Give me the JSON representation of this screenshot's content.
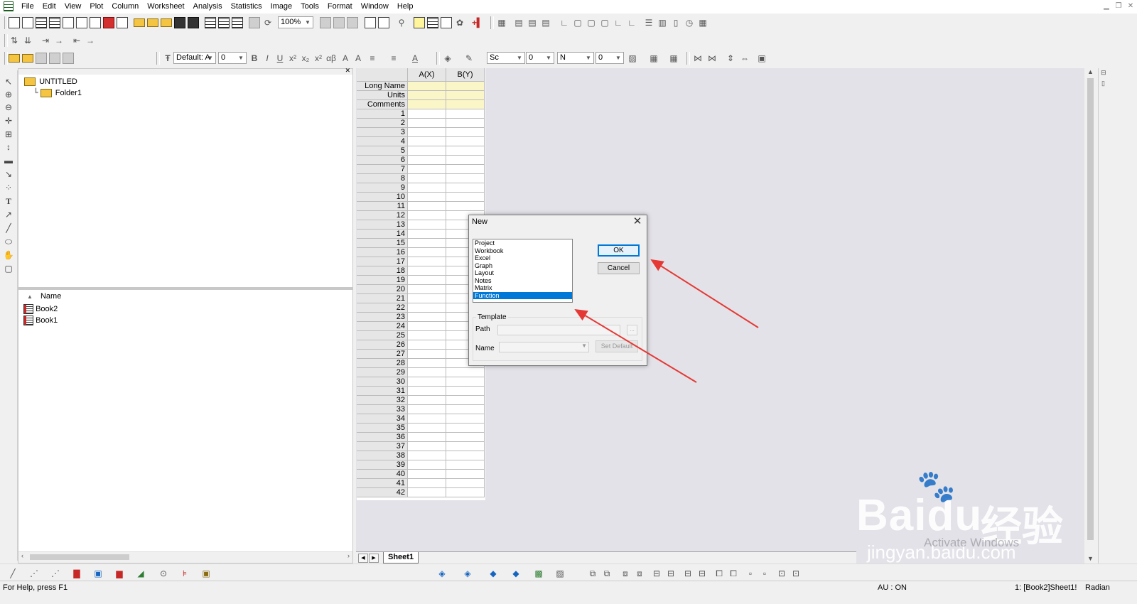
{
  "menubar": {
    "items": [
      "File",
      "Edit",
      "View",
      "Plot",
      "Column",
      "Worksheet",
      "Analysis",
      "Statistics",
      "Image",
      "Tools",
      "Format",
      "Window",
      "Help"
    ]
  },
  "toolbar": {
    "zoom": "100%",
    "font_name": "Default: A",
    "font_size": "0",
    "line_style": "Sc",
    "line_width": "0",
    "fill_box": "N",
    "fill_value": "0"
  },
  "explorer": {
    "root": "UNTITLED",
    "folder": "Folder1",
    "column_header": "Name",
    "items": [
      "Book2",
      "Book1"
    ]
  },
  "worksheet": {
    "columns": [
      "A(X)",
      "B(Y)"
    ],
    "meta_rows": [
      "Long Name",
      "Units",
      "Comments"
    ],
    "row_numbers": [
      "1",
      "2",
      "3",
      "4",
      "5",
      "6",
      "7",
      "8",
      "9",
      "10",
      "11",
      "12",
      "13",
      "14",
      "15",
      "16",
      "17",
      "18",
      "19",
      "20",
      "21",
      "22",
      "23",
      "24",
      "25",
      "26",
      "27",
      "28",
      "29",
      "30",
      "31",
      "32",
      "33",
      "34",
      "35",
      "36",
      "37",
      "38",
      "39",
      "40",
      "41",
      "42"
    ],
    "sheet_tab": "Sheet1"
  },
  "dialog": {
    "title": "New",
    "list_items": [
      "Project",
      "Workbook",
      "Excel",
      "Graph",
      "Layout",
      "Notes",
      "Matrix",
      "Function"
    ],
    "selected_index": 7,
    "ok_label": "OK",
    "cancel_label": "Cancel",
    "template_label": "Template",
    "path_label": "Path",
    "name_label": "Name",
    "browse_label": "...",
    "set_default_label": "Set Default"
  },
  "statusbar": {
    "help": "For Help, press F1",
    "au": "AU : ON",
    "window": "1: [Book2]Sheet1!",
    "angle": "Radian"
  },
  "watermark": {
    "brand": "Baidu",
    "cn": "经验",
    "url": "jingyan.baidu.com",
    "activate": "Activate Windows"
  },
  "colors": {
    "selection": "#0078d7",
    "meta_row": "#fbf6c8",
    "mdi_background": "#e3e2e8",
    "annotation_arrow": "#e53935"
  }
}
